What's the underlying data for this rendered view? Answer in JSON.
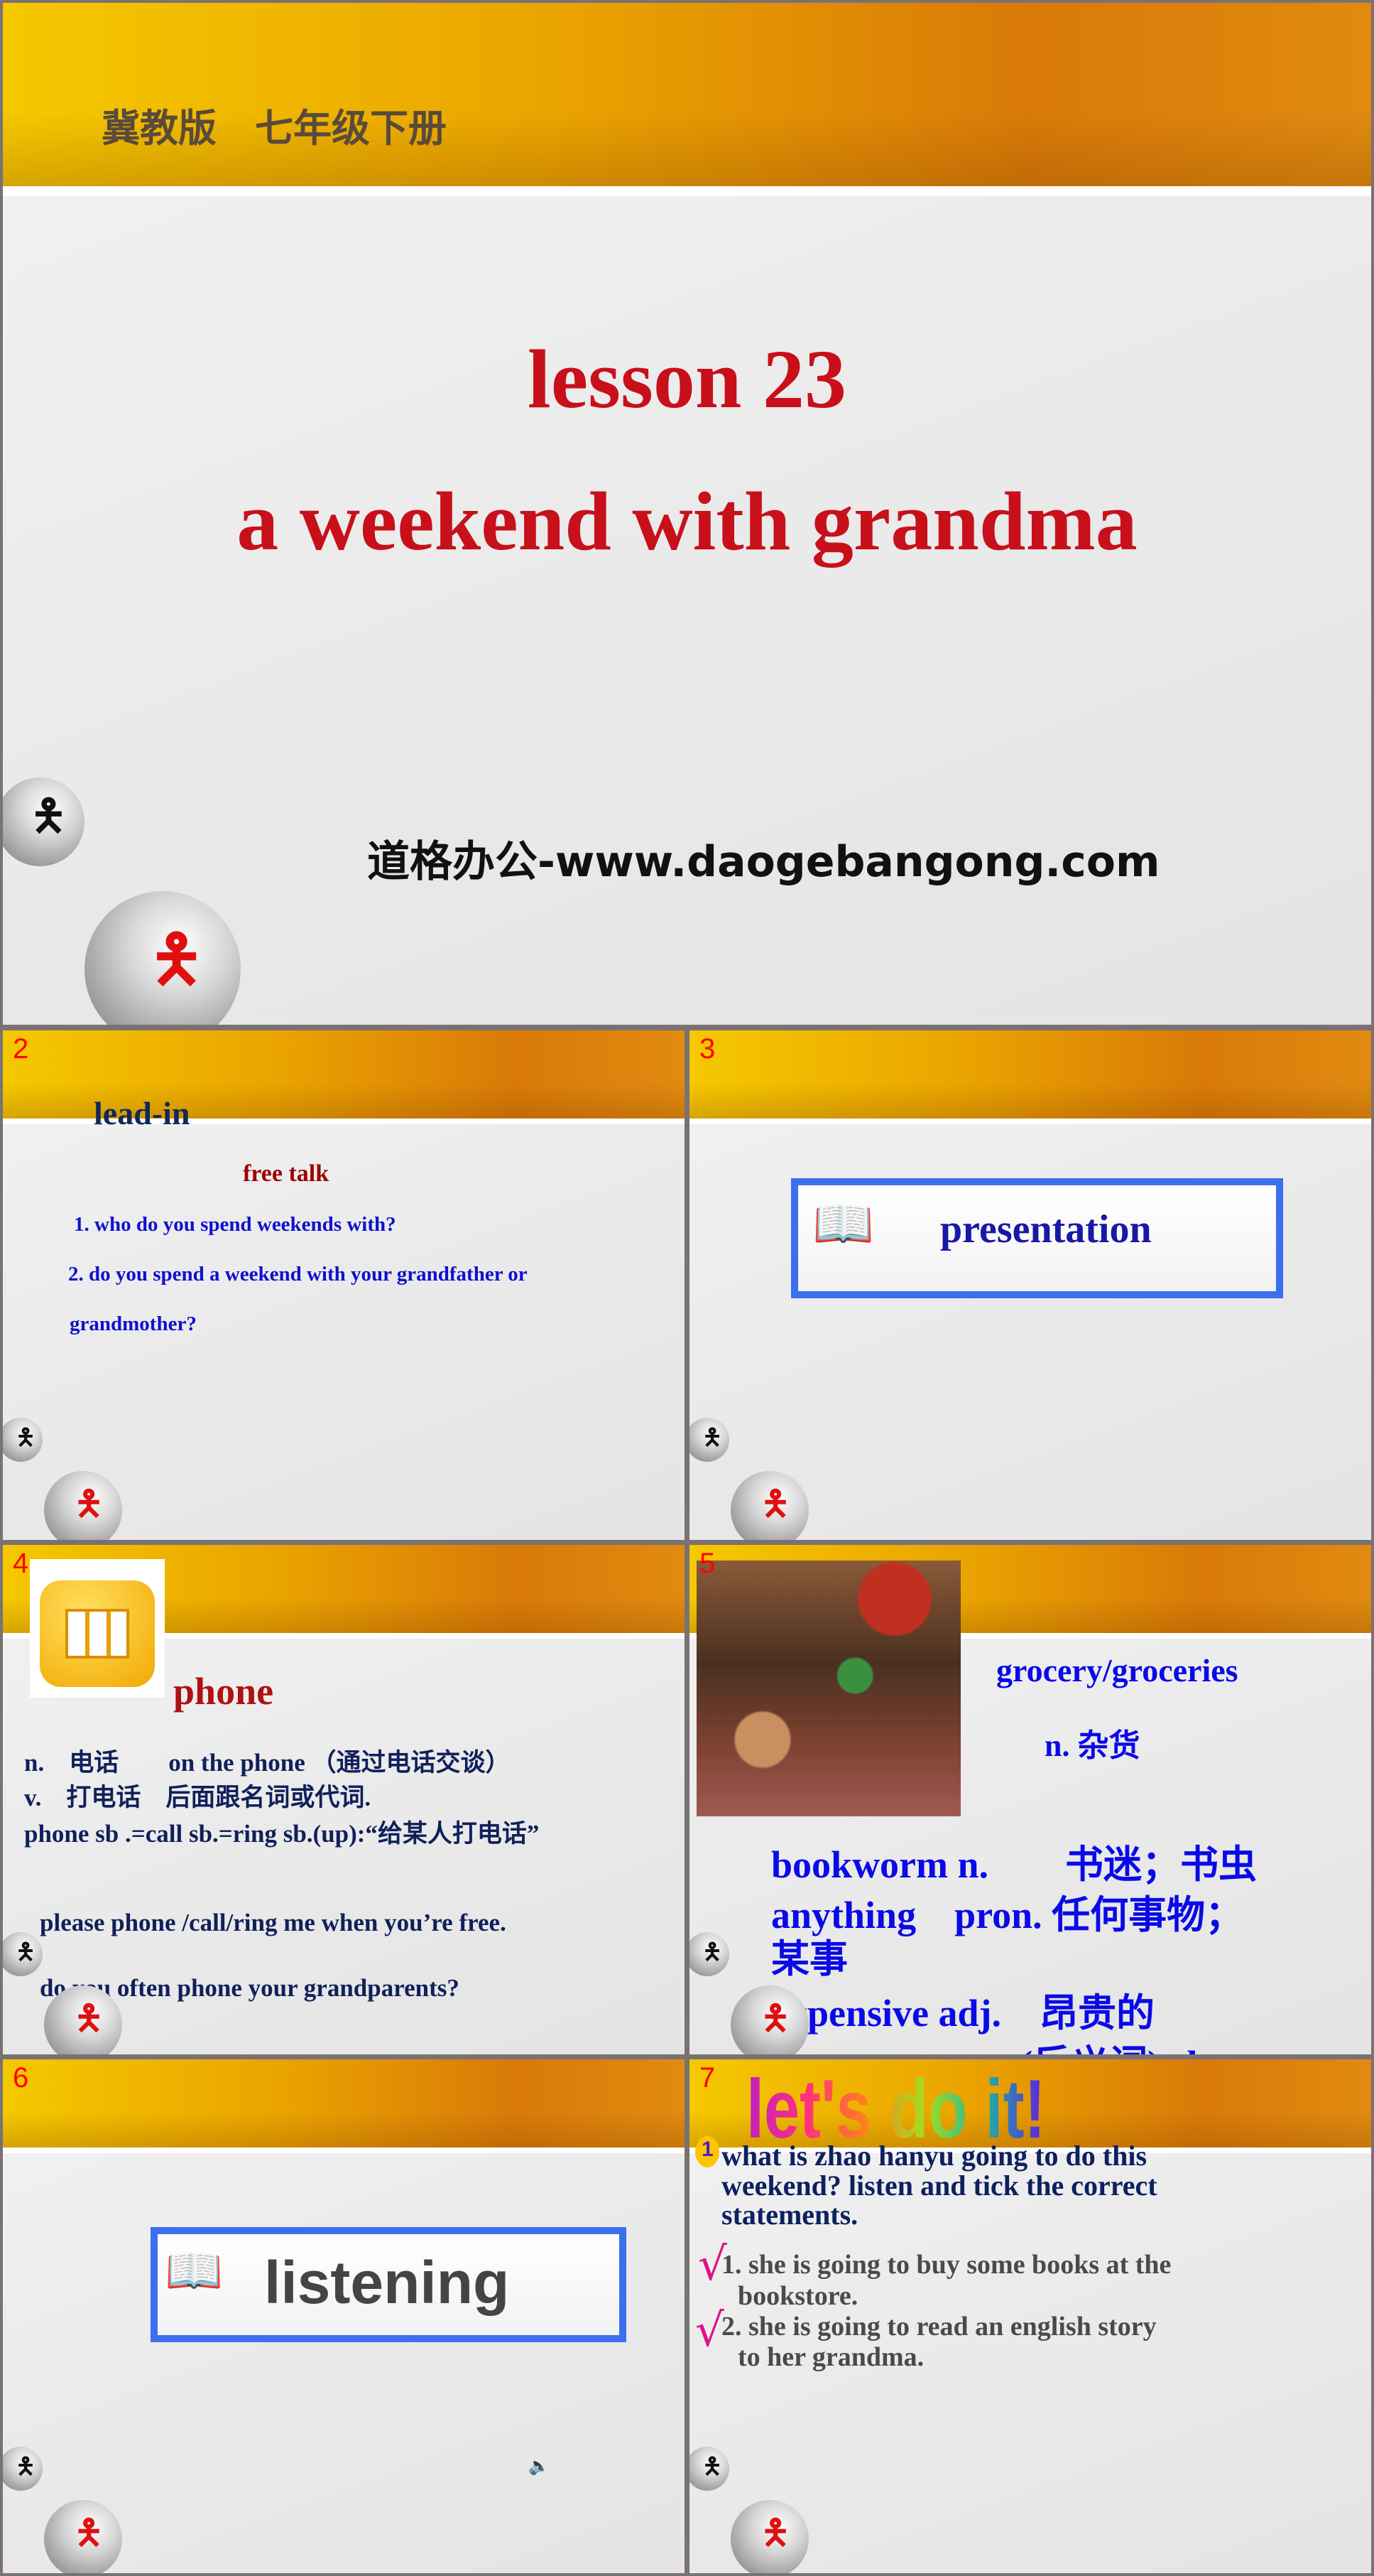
{
  "slide1": {
    "header": "冀教版　七年级下册",
    "title_line1": "lesson  23",
    "title_line2": "a weekend with grandma",
    "watermark": "道格办公-www.daogebangong.com"
  },
  "slide2": {
    "number": "2",
    "heading": "lead-in",
    "subheading": "free talk",
    "q1": "1. who do you spend weekends with?",
    "q2": "2. do you spend a weekend with your grandfather or",
    "q2b": "grandmother?"
  },
  "slide3": {
    "number": "3",
    "label": "presentation",
    "icon": "book-quill-icon"
  },
  "slide4": {
    "number": "4",
    "word": "phone",
    "icon": "telephone-icon",
    "lines": [
      "n.　电话　　on the phone （通过电话交谈）",
      "v.　打电话　后面跟名词或代词.",
      "phone  sb .=call sb.=ring sb.(up):“给某人打电话”"
    ],
    "ex1": "please phone /call/ring me when you’re free.",
    "ex2": "do you often phone your grandparents?"
  },
  "slide5": {
    "number": "5",
    "word": "grocery/groceries",
    "meaning": "n. 杂货",
    "lines": [
      "bookworm n.　　书迷；书虫",
      "anything　pron. 任何事物；",
      "某事",
      "expensive  adj.　昂贵的",
      "(反义词) cheap"
    ]
  },
  "slide6": {
    "number": "6",
    "label": "listening",
    "icon": "speaker-icon"
  },
  "slide7": {
    "number": "7",
    "wordart": "let's do it!",
    "badge": "1",
    "question": [
      "what is zhao hanyu going to do this",
      "weekend? listen and tick the correct",
      "statements."
    ],
    "tick": "√",
    "s1": "1. she is going to buy some books at the",
    "s1b": "bookstore.",
    "s2": "2. she is going to read an english story",
    "s2b": "to her grandma."
  },
  "colors": {
    "header_start": "#f5c800",
    "header_end": "#d97a08",
    "title_red": "#c8101a",
    "blue": "#1010e0",
    "navy": "#0d2060",
    "frame": "#3c6ff0"
  }
}
